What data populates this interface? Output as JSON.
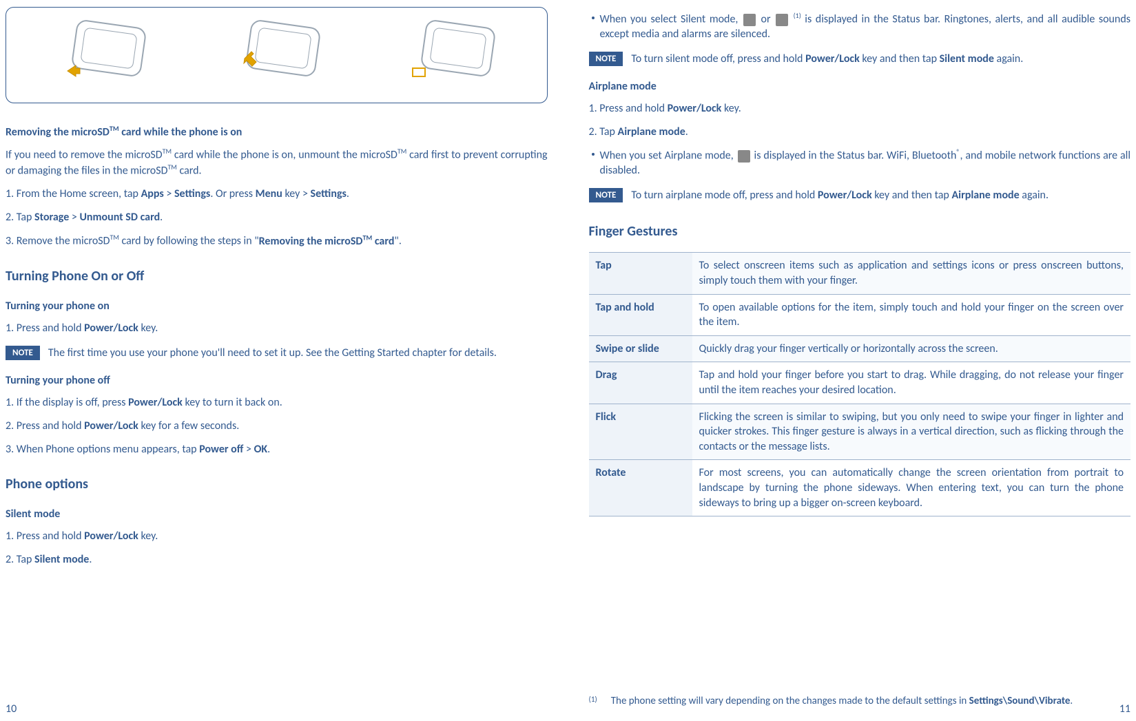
{
  "left": {
    "removing_heading_pre": "Removing the microSD",
    "removing_heading_post": " card while the phone is on",
    "removing_intro_1a": "If you need to remove the microSD",
    "removing_intro_1b": " card while the phone is on, unmount the microSD",
    "removing_intro_1c": " card first to prevent corrupting or damaging the files in the microSD",
    "removing_intro_1d": " card.",
    "step1_pre": "1. From the Home screen, tap ",
    "step1_apps": "Apps",
    "step1_gt1": " > ",
    "step1_settings": "Settings",
    "step1_mid": ". Or press ",
    "step1_menu": "Menu",
    "step1_key": " key > ",
    "step1_settings2": "Settings",
    "step1_end": ".",
    "step2_pre": "2. Tap ",
    "step2_storage": "Storage",
    "step2_gt": " > ",
    "step2_unmount": "Unmount SD card",
    "step2_end": ".",
    "step3_pre": "3. Remove the microSD",
    "step3_mid": " card by following the steps in \"",
    "step3_bold_pre": "Removing the microSD",
    "step3_bold_post": " card",
    "step3_end": "\".",
    "turning_heading": "Turning Phone On or Off",
    "turn_on_sub": "Turning your phone on",
    "turn_on_1_pre": "1. Press and hold ",
    "turn_on_1_bold": "Power/Lock",
    "turn_on_1_end": " key.",
    "note_label": "NOTE",
    "turn_on_note": "The first time you use your phone you'll need to set it up. See the Getting Started chapter for details.",
    "turn_off_sub": "Turning your phone off",
    "turn_off_1_pre": "1. If the display is off, press ",
    "turn_off_1_bold": "Power/Lock",
    "turn_off_1_end": " key to turn it back on.",
    "turn_off_2_pre": "2. Press and hold ",
    "turn_off_2_bold": "Power/Lock",
    "turn_off_2_end": " key for a few seconds.",
    "turn_off_3_pre": "3. When Phone options menu appears, tap ",
    "turn_off_3_bold1": "Power off",
    "turn_off_3_gt": " > ",
    "turn_off_3_bold2": "OK",
    "turn_off_3_end": ".",
    "phone_options_heading": "Phone options",
    "silent_sub": "Silent mode",
    "silent_1_pre": "1. Press and hold ",
    "silent_1_bold": "Power/Lock",
    "silent_1_end": " key.",
    "silent_2_pre": "2. Tap ",
    "silent_2_bold": "Silent mode",
    "silent_2_end": ".",
    "page_num": "10"
  },
  "right": {
    "silent_bullet_a": "When you select Silent mode, ",
    "silent_bullet_b": " or ",
    "silent_bullet_sup": "(1)",
    "silent_bullet_c": " is displayed in the Status bar. Ringtones, alerts, and all audible sounds except media and alarms are silenced.",
    "note_label": "NOTE",
    "silent_note_a": "To turn silent mode off, press and hold ",
    "silent_note_b": "Power/Lock",
    "silent_note_c": " key and then tap ",
    "silent_note_d": "Silent mode",
    "silent_note_e": " again.",
    "airplane_sub": "Airplane mode",
    "air_1_pre": "1. Press and hold ",
    "air_1_bold": "Power/Lock",
    "air_1_end": " key.",
    "air_2_pre": "2. Tap ",
    "air_2_bold": "Airplane mode",
    "air_2_end": ".",
    "air_bullet_a": "When you set Airplane mode, ",
    "air_bullet_b": " is displayed in the Status bar. WiFi, Bluetooth",
    "air_bullet_sup": "®",
    "air_bullet_c": ", and mobile network functions are all disabled.",
    "air_note_a": "To turn airplane mode off, press and hold ",
    "air_note_b": "Power/Lock",
    "air_note_c": " key and then tap ",
    "air_note_d": "Airplane mode",
    "air_note_e": " again.",
    "gestures_heading": "Finger Gestures",
    "gestures": [
      {
        "name": "Tap",
        "desc": "To select onscreen items such as application and settings icons or press onscreen buttons, simply touch them with your finger."
      },
      {
        "name": "Tap and hold",
        "desc": "To open available options for the item, simply touch and hold your finger on the screen over the item."
      },
      {
        "name": "Swipe or slide",
        "desc": "Quickly drag your finger vertically or horizontally across the screen."
      },
      {
        "name": "Drag",
        "desc": "Tap and hold your finger before you start to drag. While dragging, do not release your finger until the item reaches your desired location."
      },
      {
        "name": "Flick",
        "desc": "Flicking the screen is similar to swiping, but you only need to swipe your finger in lighter and quicker strokes. This finger gesture is always in a vertical direction, such as flicking through the contacts or the message lists."
      },
      {
        "name": "Rotate",
        "desc": "For most screens, you can automatically change the screen orientation from portrait to landscape by turning the phone sideways. When entering text, you can turn the phone sideways to bring up a bigger on-screen keyboard."
      }
    ],
    "footnote_marker": "(1)",
    "footnote_a": "The phone setting will vary depending on the changes made to the default settings in ",
    "footnote_b": "Settings\\Sound\\Vibrate",
    "footnote_c": ".",
    "page_num": "11"
  },
  "tm": "TM"
}
